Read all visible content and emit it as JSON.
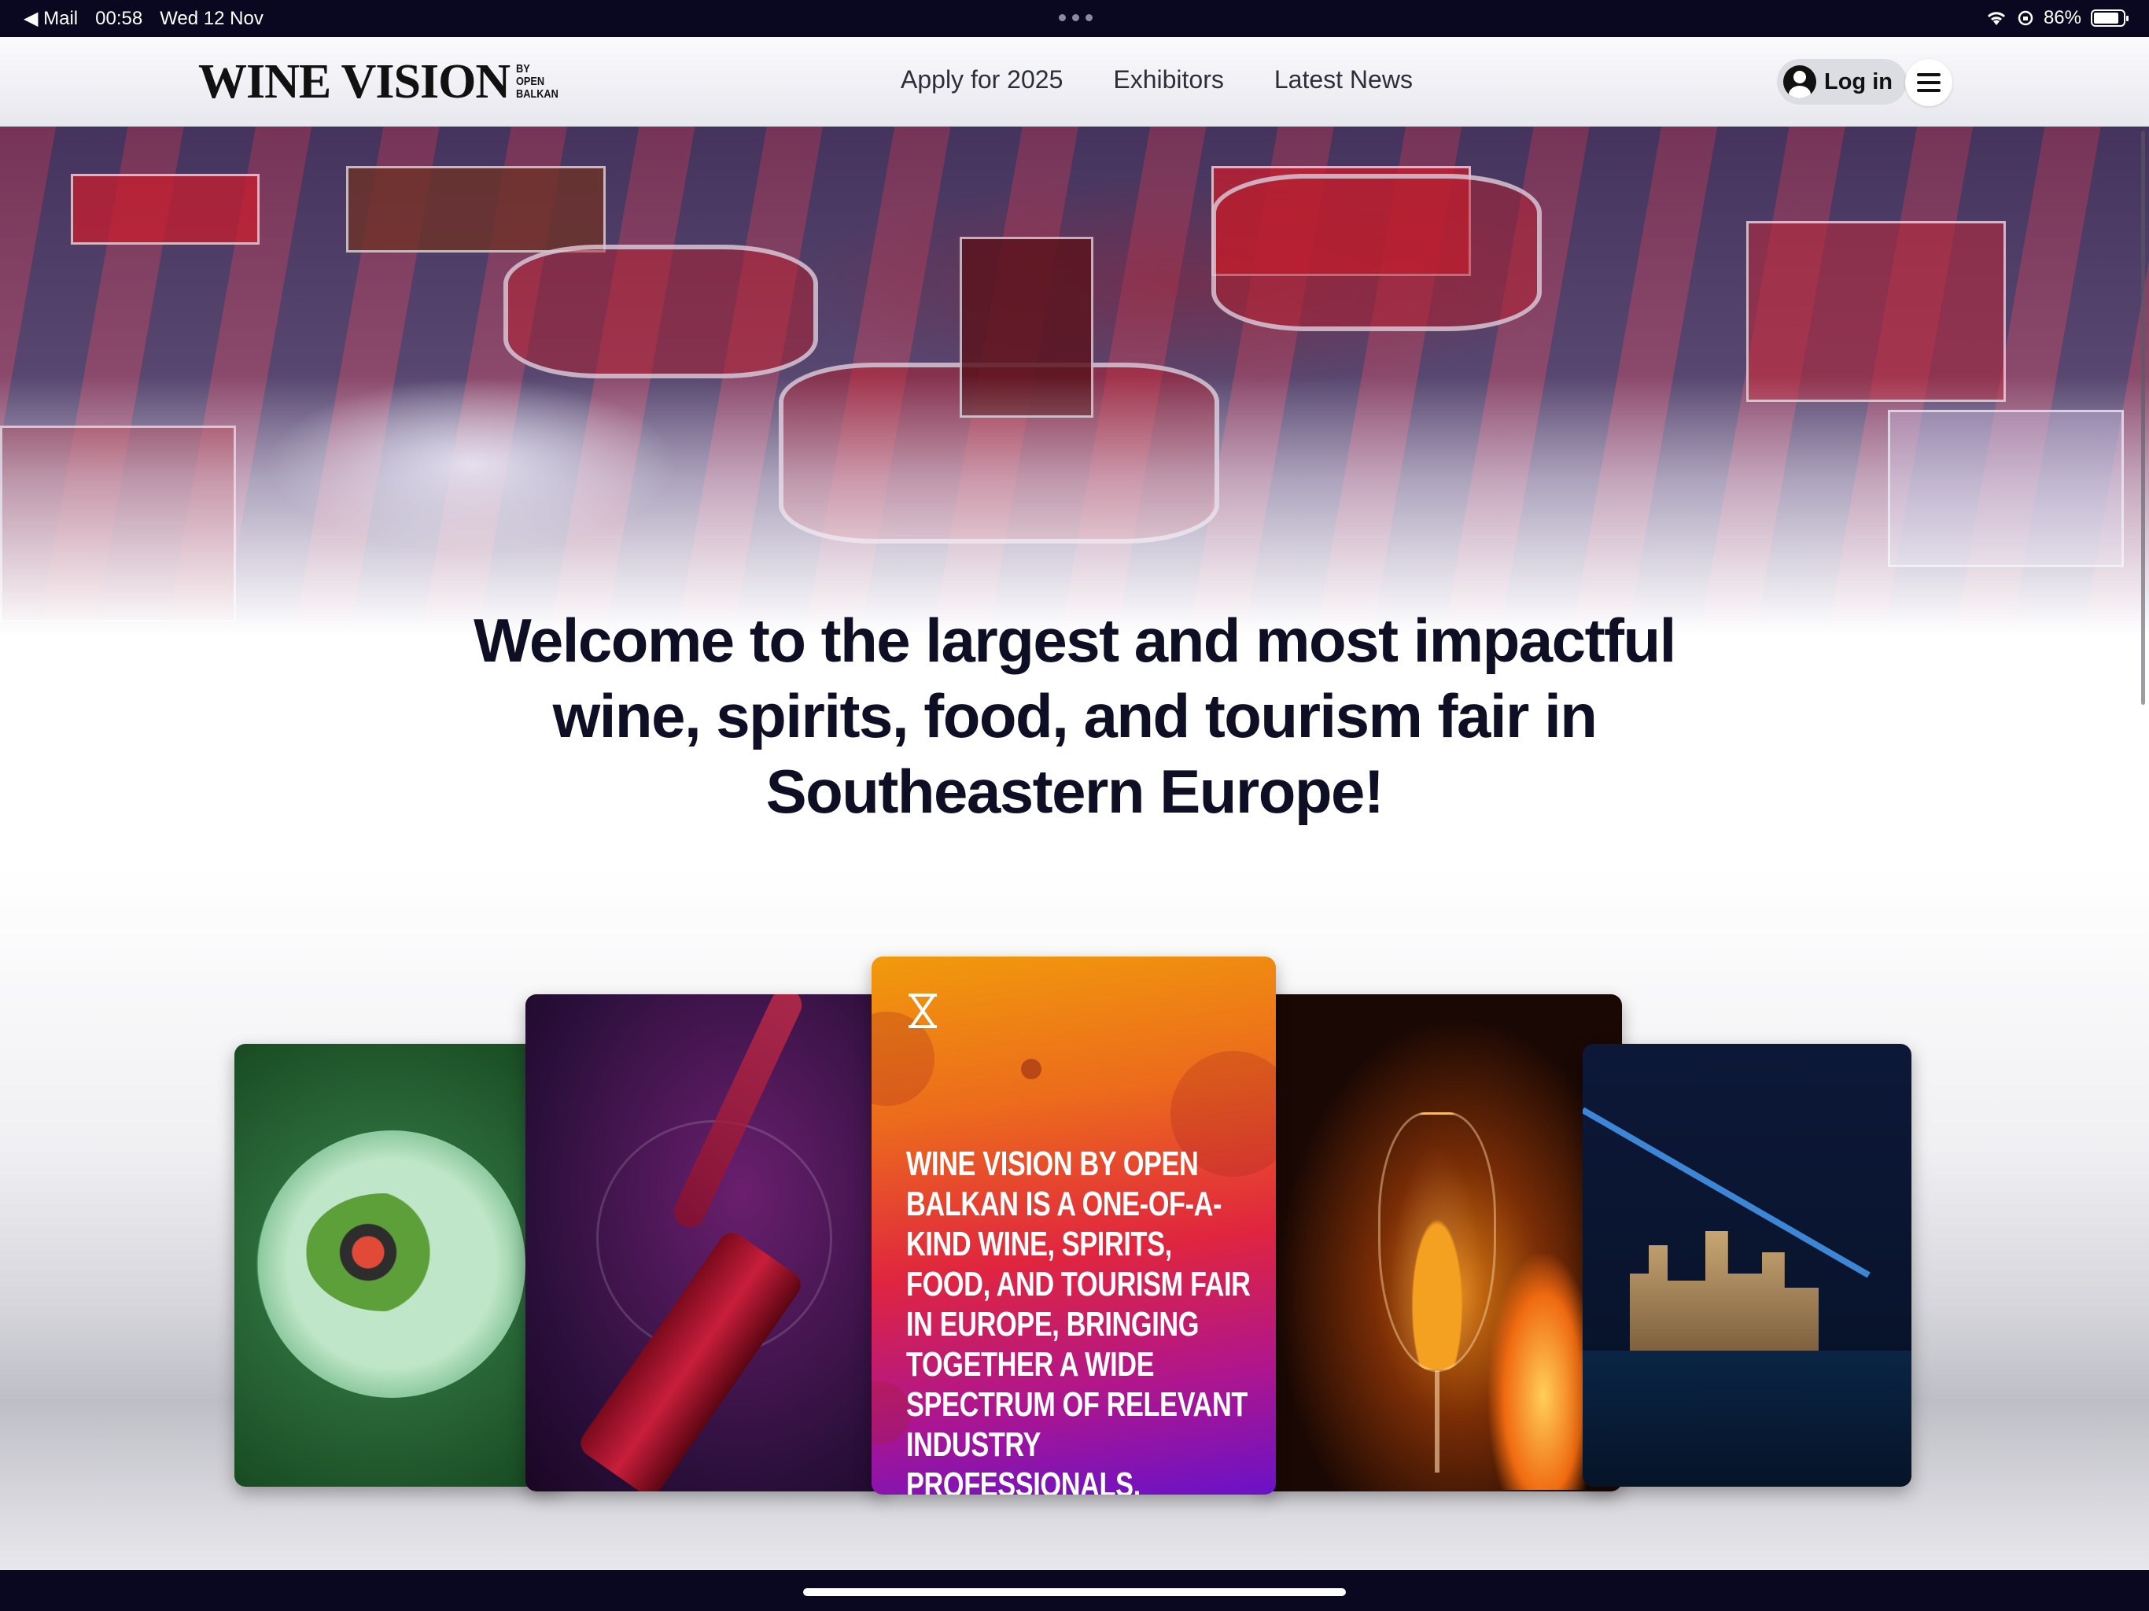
{
  "status_bar": {
    "back_app": "◀ Mail",
    "time": "00:58",
    "date": "Wed 12 Nov",
    "battery": "86%",
    "battery_level": 0.86
  },
  "nav": {
    "logo_main": "WINE VISION",
    "logo_sub": "BY OPEN BALKAN",
    "links": [
      "Apply for 2025",
      "Exhibitors",
      "Latest News"
    ],
    "login": "Log in"
  },
  "hero": {
    "headline": "Welcome to the largest and most impactful wine, spirits, food, and tourism fair in Southeastern Europe!"
  },
  "cards": {
    "main_text": "Wine Vision by Open Balkan is a one-of-a-kind wine, spirits, food, and tourism fair in Europe, bringing together a wide spectrum of relevant industry professionals, markets, and brands."
  },
  "colors": {
    "dark_bar": "#0a0820",
    "card_gradient_top": "#f19a0c",
    "card_gradient_bottom": "#6a12c8"
  }
}
